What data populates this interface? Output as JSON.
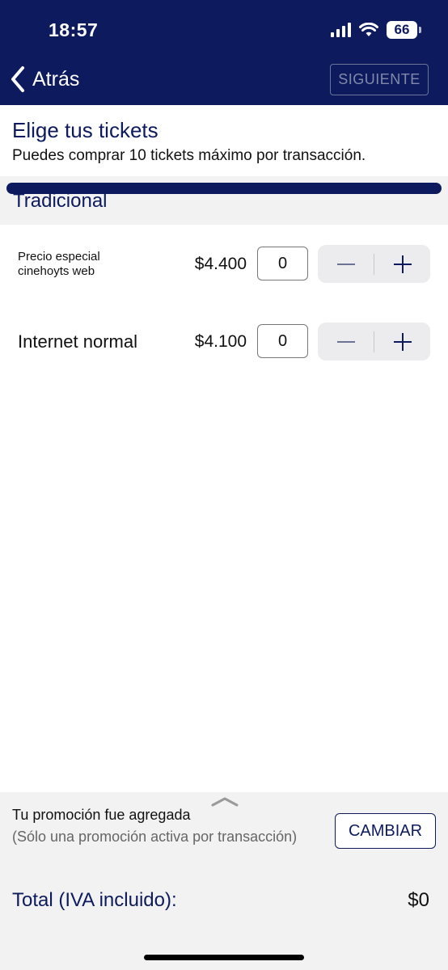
{
  "status_bar": {
    "time": "18:57",
    "battery": "66"
  },
  "nav": {
    "back_label": "Atrás",
    "next_label": "SIGUIENTE"
  },
  "header": {
    "title": "Elige tus tickets",
    "subtitle": "Puedes comprar 10 tickets máximo por transacción."
  },
  "category": {
    "label": "Tradicional"
  },
  "tickets": [
    {
      "name_line1": "Precio especial",
      "name_line2": "cinehoyts web",
      "price": "$4.400",
      "quantity": "0"
    },
    {
      "name": "Internet normal",
      "price": "$4.100",
      "quantity": "0"
    }
  ],
  "promo": {
    "title": "Tu promoción fue agregada",
    "note": "(Sólo una promoción activa por transacción)",
    "change_label": "CAMBIAR"
  },
  "total": {
    "label": "Total (IVA incluido):",
    "value": "$0"
  },
  "colors": {
    "brand_navy": "#0d1b5e",
    "panel_gray": "#f2f2f2"
  }
}
